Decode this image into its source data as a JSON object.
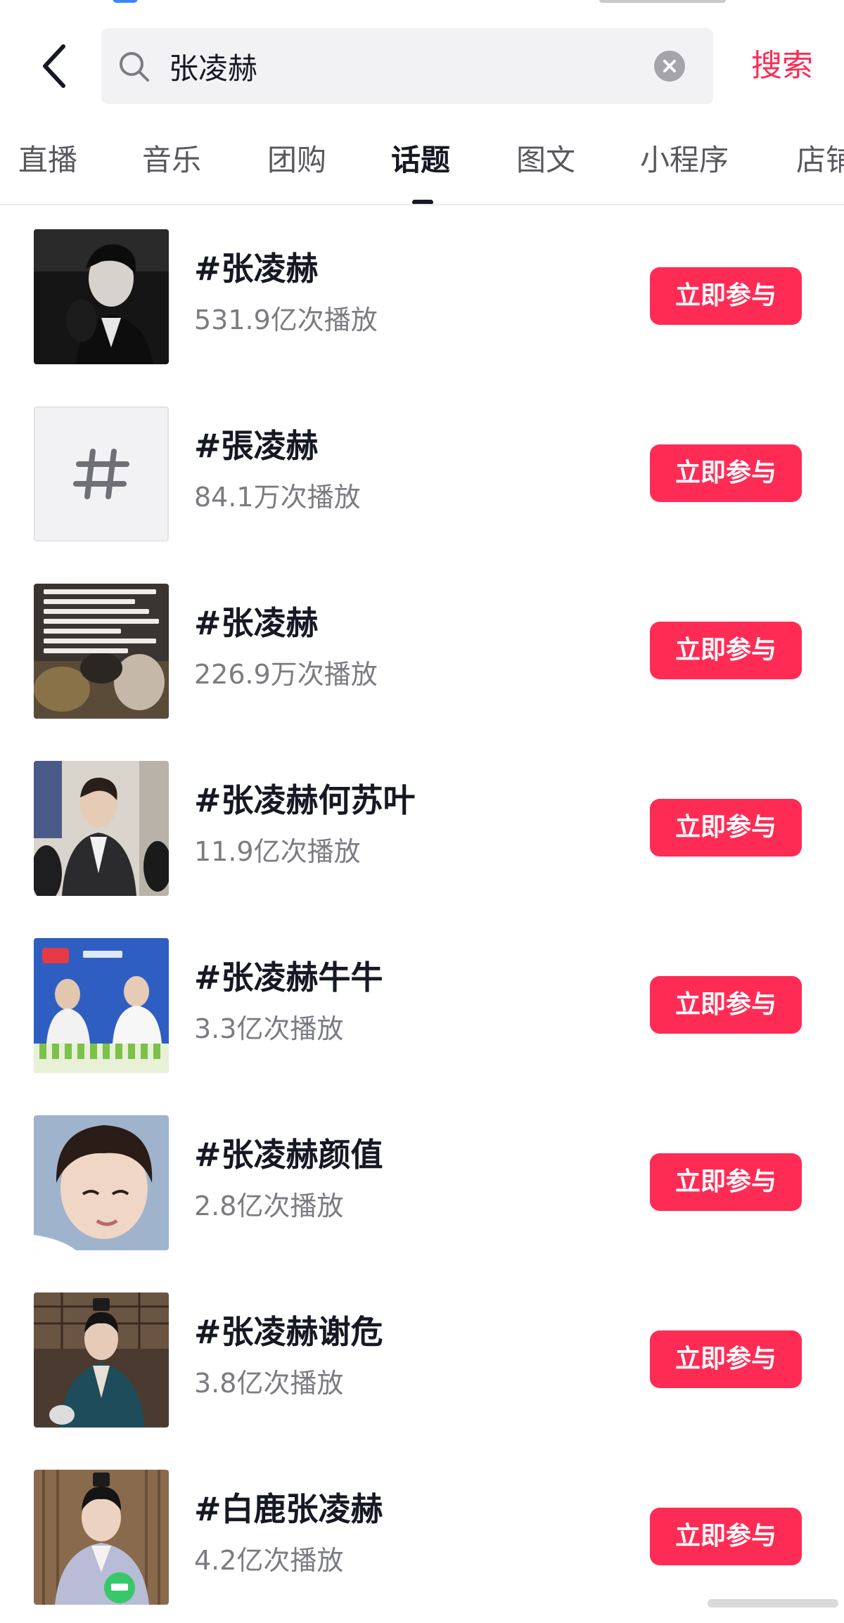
{
  "search": {
    "query": "张凌赫",
    "submit_label": "搜索"
  },
  "tabs": [
    {
      "label": "直播",
      "active": false
    },
    {
      "label": "音乐",
      "active": false
    },
    {
      "label": "团购",
      "active": false
    },
    {
      "label": "话题",
      "active": true
    },
    {
      "label": "图文",
      "active": false
    },
    {
      "label": "小程序",
      "active": false
    },
    {
      "label": "店铺",
      "active": false
    }
  ],
  "topics": [
    {
      "name": "#张凌赫",
      "plays": "531.9亿次播放",
      "button": "立即参与",
      "thumbnail": "portrait-dark"
    },
    {
      "name": "#張凌赫",
      "plays": "84.1万次播放",
      "button": "立即参与",
      "thumbnail": "hash-placeholder"
    },
    {
      "name": "#张凌赫",
      "plays": "226.9万次播放",
      "button": "立即参与",
      "thumbnail": "text-overlay-photo"
    },
    {
      "name": "#张凌赫何苏叶",
      "plays": "11.9亿次播放",
      "button": "立即参与",
      "thumbnail": "event-photo"
    },
    {
      "name": "#张凌赫牛牛",
      "plays": "3.3亿次播放",
      "button": "立即参与",
      "thumbnail": "livestream-photo"
    },
    {
      "name": "#张凌赫颜值",
      "plays": "2.8亿次播放",
      "button": "立即参与",
      "thumbnail": "closeup-portrait"
    },
    {
      "name": "#张凌赫谢危",
      "plays": "3.8亿次播放",
      "button": "立即参与",
      "thumbnail": "costume-drama-still"
    },
    {
      "name": "#白鹿张凌赫",
      "plays": "4.2亿次播放",
      "button": "立即参与",
      "thumbnail": "costume-drama-still"
    }
  ],
  "colors": {
    "accent": "#fe2c55",
    "text_primary": "#161823",
    "text_secondary": "#7b7c82"
  }
}
